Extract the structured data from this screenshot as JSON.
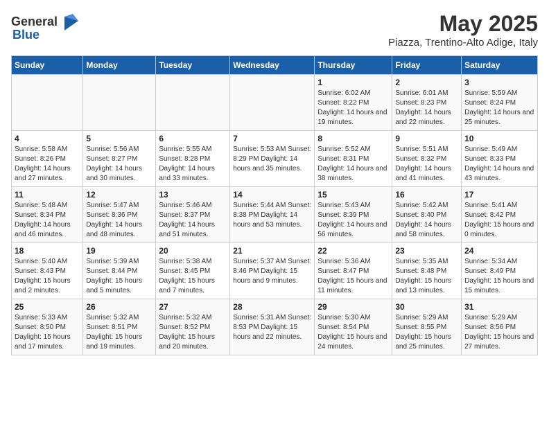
{
  "logo": {
    "general": "General",
    "blue": "Blue"
  },
  "title": "May 2025",
  "subtitle": "Piazza, Trentino-Alto Adige, Italy",
  "headers": [
    "Sunday",
    "Monday",
    "Tuesday",
    "Wednesday",
    "Thursday",
    "Friday",
    "Saturday"
  ],
  "weeks": [
    [
      {
        "day": "",
        "info": ""
      },
      {
        "day": "",
        "info": ""
      },
      {
        "day": "",
        "info": ""
      },
      {
        "day": "",
        "info": ""
      },
      {
        "day": "1",
        "info": "Sunrise: 6:02 AM\nSunset: 8:22 PM\nDaylight: 14 hours\nand 19 minutes."
      },
      {
        "day": "2",
        "info": "Sunrise: 6:01 AM\nSunset: 8:23 PM\nDaylight: 14 hours\nand 22 minutes."
      },
      {
        "day": "3",
        "info": "Sunrise: 5:59 AM\nSunset: 8:24 PM\nDaylight: 14 hours\nand 25 minutes."
      }
    ],
    [
      {
        "day": "4",
        "info": "Sunrise: 5:58 AM\nSunset: 8:26 PM\nDaylight: 14 hours\nand 27 minutes."
      },
      {
        "day": "5",
        "info": "Sunrise: 5:56 AM\nSunset: 8:27 PM\nDaylight: 14 hours\nand 30 minutes."
      },
      {
        "day": "6",
        "info": "Sunrise: 5:55 AM\nSunset: 8:28 PM\nDaylight: 14 hours\nand 33 minutes."
      },
      {
        "day": "7",
        "info": "Sunrise: 5:53 AM\nSunset: 8:29 PM\nDaylight: 14 hours\nand 35 minutes."
      },
      {
        "day": "8",
        "info": "Sunrise: 5:52 AM\nSunset: 8:31 PM\nDaylight: 14 hours\nand 38 minutes."
      },
      {
        "day": "9",
        "info": "Sunrise: 5:51 AM\nSunset: 8:32 PM\nDaylight: 14 hours\nand 41 minutes."
      },
      {
        "day": "10",
        "info": "Sunrise: 5:49 AM\nSunset: 8:33 PM\nDaylight: 14 hours\nand 43 minutes."
      }
    ],
    [
      {
        "day": "11",
        "info": "Sunrise: 5:48 AM\nSunset: 8:34 PM\nDaylight: 14 hours\nand 46 minutes."
      },
      {
        "day": "12",
        "info": "Sunrise: 5:47 AM\nSunset: 8:36 PM\nDaylight: 14 hours\nand 48 minutes."
      },
      {
        "day": "13",
        "info": "Sunrise: 5:46 AM\nSunset: 8:37 PM\nDaylight: 14 hours\nand 51 minutes."
      },
      {
        "day": "14",
        "info": "Sunrise: 5:44 AM\nSunset: 8:38 PM\nDaylight: 14 hours\nand 53 minutes."
      },
      {
        "day": "15",
        "info": "Sunrise: 5:43 AM\nSunset: 8:39 PM\nDaylight: 14 hours\nand 56 minutes."
      },
      {
        "day": "16",
        "info": "Sunrise: 5:42 AM\nSunset: 8:40 PM\nDaylight: 14 hours\nand 58 minutes."
      },
      {
        "day": "17",
        "info": "Sunrise: 5:41 AM\nSunset: 8:42 PM\nDaylight: 15 hours\nand 0 minutes."
      }
    ],
    [
      {
        "day": "18",
        "info": "Sunrise: 5:40 AM\nSunset: 8:43 PM\nDaylight: 15 hours\nand 2 minutes."
      },
      {
        "day": "19",
        "info": "Sunrise: 5:39 AM\nSunset: 8:44 PM\nDaylight: 15 hours\nand 5 minutes."
      },
      {
        "day": "20",
        "info": "Sunrise: 5:38 AM\nSunset: 8:45 PM\nDaylight: 15 hours\nand 7 minutes."
      },
      {
        "day": "21",
        "info": "Sunrise: 5:37 AM\nSunset: 8:46 PM\nDaylight: 15 hours\nand 9 minutes."
      },
      {
        "day": "22",
        "info": "Sunrise: 5:36 AM\nSunset: 8:47 PM\nDaylight: 15 hours\nand 11 minutes."
      },
      {
        "day": "23",
        "info": "Sunrise: 5:35 AM\nSunset: 8:48 PM\nDaylight: 15 hours\nand 13 minutes."
      },
      {
        "day": "24",
        "info": "Sunrise: 5:34 AM\nSunset: 8:49 PM\nDaylight: 15 hours\nand 15 minutes."
      }
    ],
    [
      {
        "day": "25",
        "info": "Sunrise: 5:33 AM\nSunset: 8:50 PM\nDaylight: 15 hours\nand 17 minutes."
      },
      {
        "day": "26",
        "info": "Sunrise: 5:32 AM\nSunset: 8:51 PM\nDaylight: 15 hours\nand 19 minutes."
      },
      {
        "day": "27",
        "info": "Sunrise: 5:32 AM\nSunset: 8:52 PM\nDaylight: 15 hours\nand 20 minutes."
      },
      {
        "day": "28",
        "info": "Sunrise: 5:31 AM\nSunset: 8:53 PM\nDaylight: 15 hours\nand 22 minutes."
      },
      {
        "day": "29",
        "info": "Sunrise: 5:30 AM\nSunset: 8:54 PM\nDaylight: 15 hours\nand 24 minutes."
      },
      {
        "day": "30",
        "info": "Sunrise: 5:29 AM\nSunset: 8:55 PM\nDaylight: 15 hours\nand 25 minutes."
      },
      {
        "day": "31",
        "info": "Sunrise: 5:29 AM\nSunset: 8:56 PM\nDaylight: 15 hours\nand 27 minutes."
      }
    ]
  ]
}
